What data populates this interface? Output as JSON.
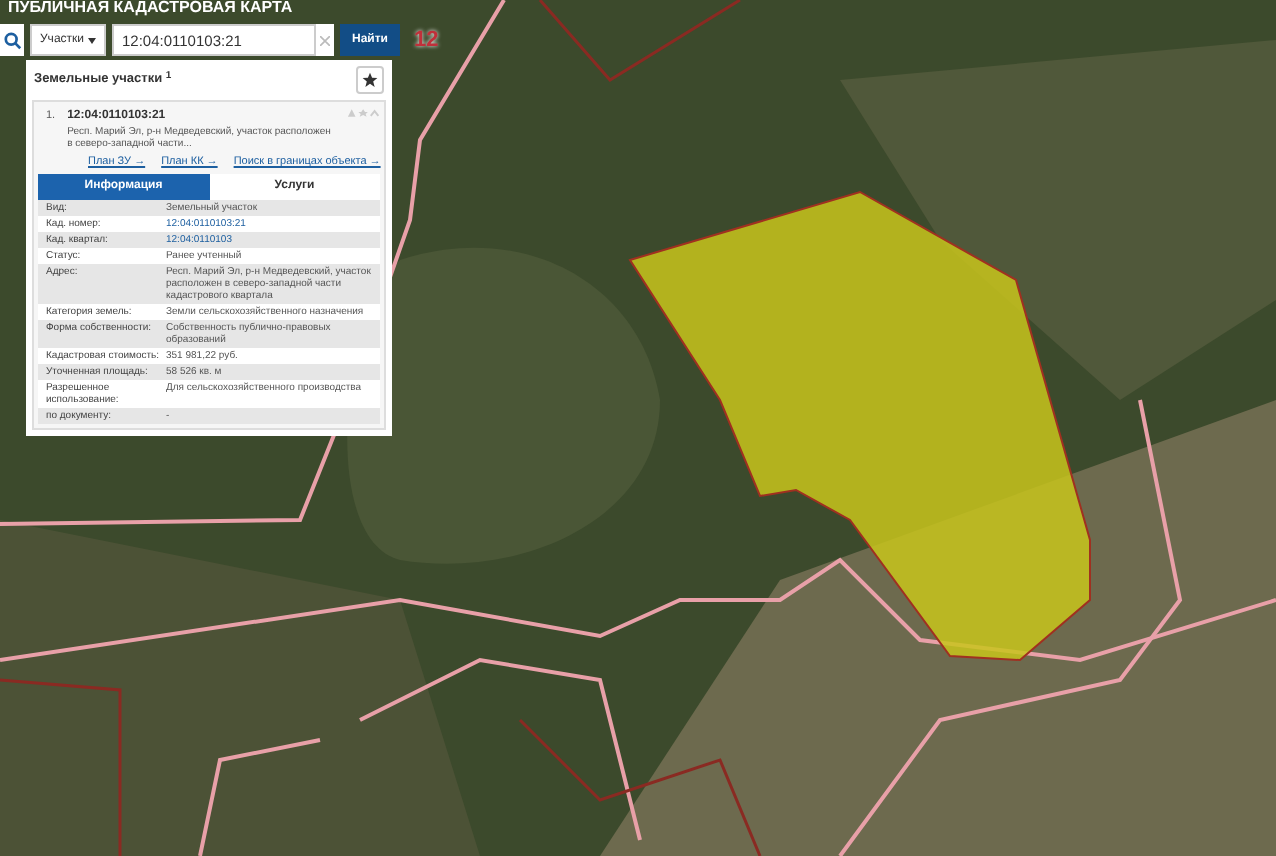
{
  "title": "ПУБЛИЧНАЯ КАДАСТРОВАЯ КАРТА",
  "search": {
    "category": "Участки",
    "value": "12:04:0110103:21",
    "button": "Найти"
  },
  "map_label": "12",
  "panel": {
    "heading": "Земельные участки",
    "count": "1",
    "result": {
      "index": "1.",
      "number": "12:04:0110103:21",
      "address": "Респ. Марий Эл, р-н Медведевский, участок расположен в северо-западной части...",
      "links": [
        "План ЗУ →",
        "План КК →",
        "Поиск в границах объекта →"
      ]
    },
    "tabs": [
      {
        "label": "Информация",
        "selected": true
      },
      {
        "label": "Услуги",
        "selected": false
      }
    ],
    "rows": [
      {
        "label": "Вид:",
        "value": "Земельный участок",
        "kind": "text"
      },
      {
        "label": "Кад. номер:",
        "value": "12:04:0110103:21",
        "kind": "link"
      },
      {
        "label": "Кад. квартал:",
        "value": "12:04:0110103",
        "kind": "link"
      },
      {
        "label": "Статус:",
        "value": "Ранее учтенный",
        "kind": "text"
      },
      {
        "label": "Адрес:",
        "value": "Респ. Марий Эл, р-н Медведевский, участок расположен в северо-западной части кадастрового квартала",
        "kind": "text"
      },
      {
        "label": "Категория земель:",
        "value": "Земли сельскохозяйственного назначения",
        "kind": "text"
      },
      {
        "label": "Форма собственности:",
        "value": "Собственность публично-правовых образований",
        "kind": "text"
      },
      {
        "label": "Кадастровая стоимость:",
        "value": "351 981,22 руб.",
        "kind": "text"
      },
      {
        "label": "Уточненная площадь:",
        "value": "58 526 кв. м",
        "kind": "text"
      },
      {
        "label": "Разрешенное использование:",
        "value": "Для сельскохозяйственного производства",
        "kind": "text"
      },
      {
        "label": "по документу:",
        "value": "-",
        "kind": "text"
      }
    ]
  }
}
